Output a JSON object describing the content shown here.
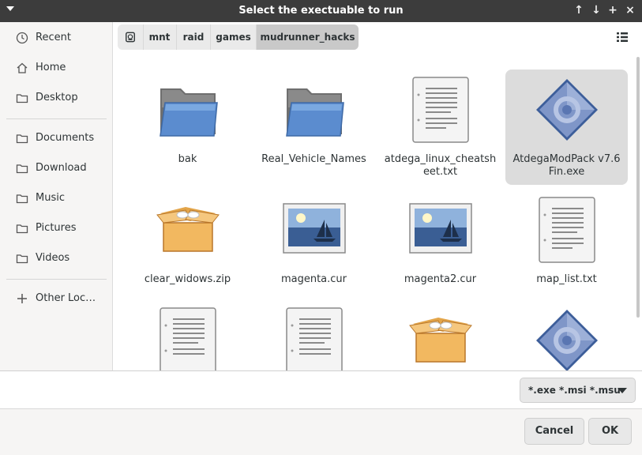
{
  "window": {
    "title": "Select the exectuable to run",
    "controls": [
      "up-arrow-icon",
      "down-arrow-icon",
      "maximize-icon",
      "close-icon"
    ]
  },
  "sidebar": {
    "items": [
      {
        "label": "Recent",
        "icon": "clock-icon"
      },
      {
        "label": "Home",
        "icon": "home-icon"
      },
      {
        "label": "Desktop",
        "icon": "folder-icon"
      },
      {
        "label": "Documents",
        "icon": "folder-icon"
      },
      {
        "label": "Download",
        "icon": "folder-icon"
      },
      {
        "label": "Music",
        "icon": "folder-icon"
      },
      {
        "label": "Pictures",
        "icon": "folder-icon"
      },
      {
        "label": "Videos",
        "icon": "folder-icon"
      },
      {
        "label": "Other Loc…",
        "icon": "plus-icon"
      }
    ]
  },
  "pathbar": {
    "root_icon": "drive-icon",
    "crumbs": [
      "mnt",
      "raid",
      "games",
      "mudrunner_hacks"
    ]
  },
  "files": [
    {
      "name": "bak",
      "type": "folder"
    },
    {
      "name": "Real_Vehicle_Names",
      "type": "folder"
    },
    {
      "name": "atdega_linux_cheatsheet.txt",
      "type": "text"
    },
    {
      "name": "AtdegaModPack v7.6 Fin.exe",
      "type": "executable",
      "selected": true
    },
    {
      "name": "clear_widows.zip",
      "type": "archive"
    },
    {
      "name": "magenta.cur",
      "type": "image"
    },
    {
      "name": "magenta2.cur",
      "type": "image"
    },
    {
      "name": "map_list.txt",
      "type": "text"
    },
    {
      "name": "",
      "type": "text"
    },
    {
      "name": "",
      "type": "text"
    },
    {
      "name": "",
      "type": "archive"
    },
    {
      "name": "",
      "type": "executable"
    }
  ],
  "footer": {
    "filter": "*.exe *.msi *.msu",
    "cancel_label": "Cancel",
    "ok_label": "OK"
  },
  "colors": {
    "titlebar": "#3c3c3c",
    "selection": "#dcdcdc",
    "folder_blue": "#5b8ccf"
  }
}
